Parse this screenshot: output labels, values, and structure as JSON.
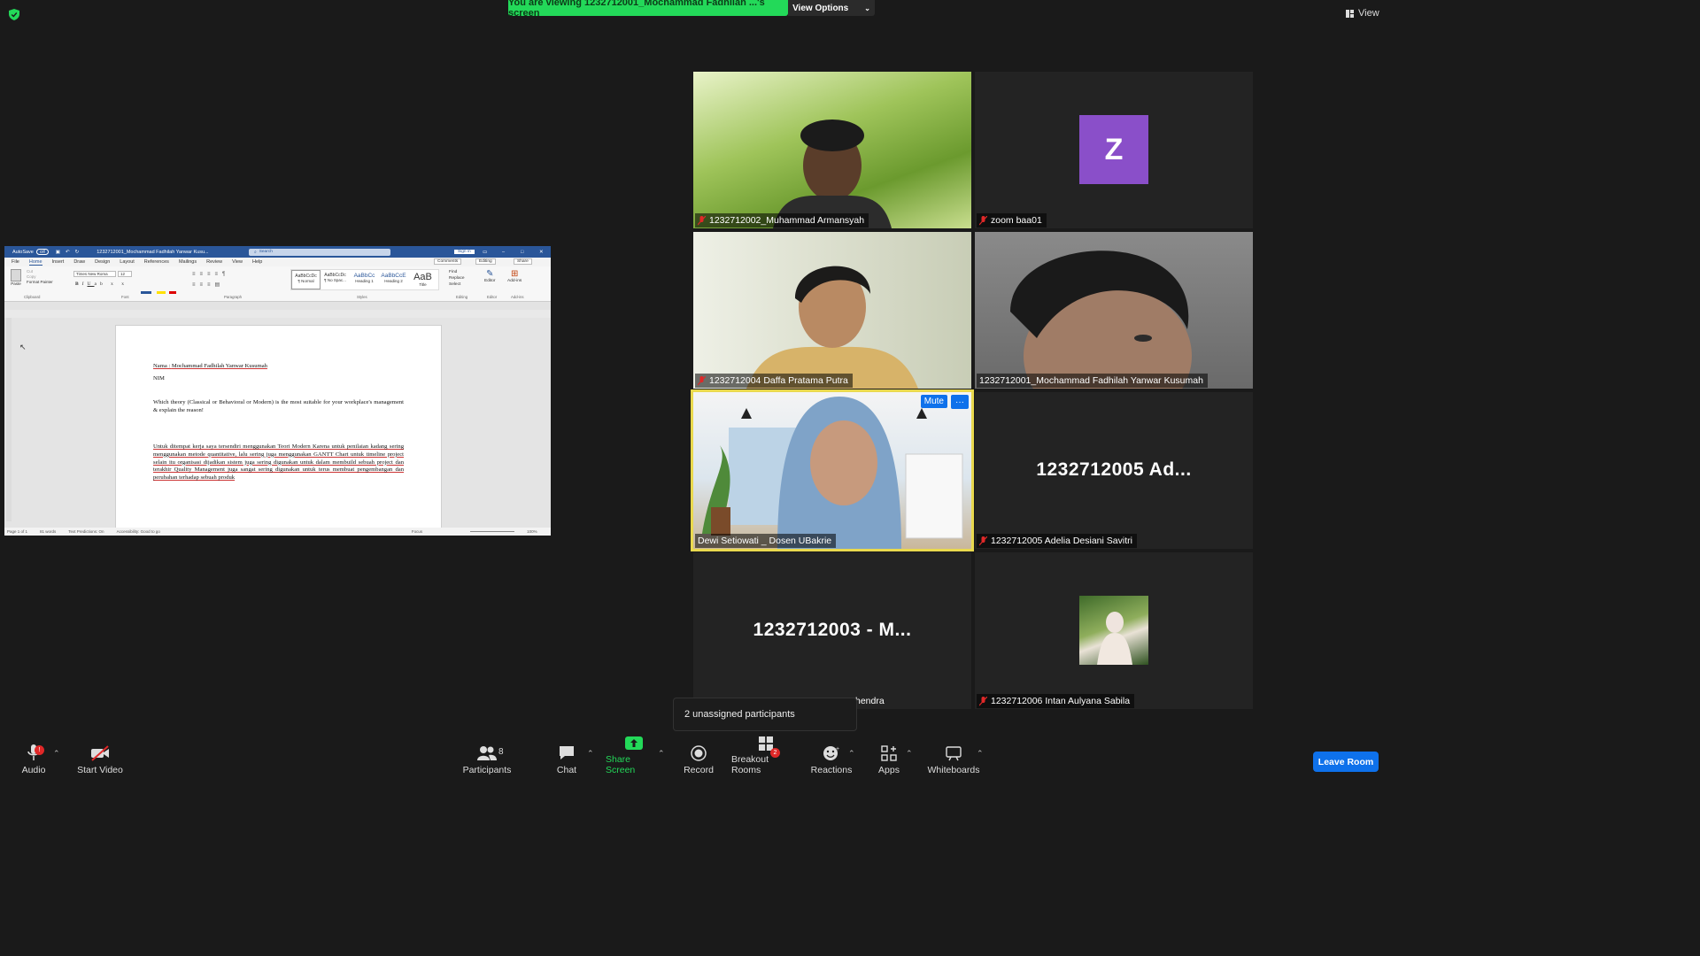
{
  "banner": {
    "viewing_text": "You are viewing 1232712001_Mochammad Fadhilah ...'s screen",
    "view_options": "View Options"
  },
  "top_right": {
    "view_label": "View"
  },
  "tiles": [
    {
      "name": "1232712002_Muhammad Armansyah",
      "muted": true
    },
    {
      "name": "zoom baa01",
      "muted": true,
      "avatar_letter": "Z"
    },
    {
      "name": "1232712004 Daffa Pratama Putra",
      "muted": true
    },
    {
      "name": "1232712001_Mochammad Fadhilah Yanwar Kusumah",
      "muted": false
    },
    {
      "name": "Dewi Setiowati _ Dosen UBakrie",
      "muted": false,
      "mute_button": "Mute",
      "more_button": "···"
    },
    {
      "name": "1232712005 Adelia Desiani Savitri",
      "muted": true,
      "big_label": "1232712005  Ad..."
    },
    {
      "name": "hendra",
      "muted": false,
      "big_label": "1232712003  -  M..."
    },
    {
      "name": "1232712006 Intan Aulyana Sabila",
      "muted": true
    }
  ],
  "doc": {
    "autosave": "AutoSave",
    "toggle": "Off",
    "file_title": "1232712001_Mochammad Fadhilah Yanwar Kusu...",
    "search": "Search",
    "signin": "Sign in",
    "menu": [
      "File",
      "Home",
      "Insert",
      "Draw",
      "Design",
      "Layout",
      "References",
      "Mailings",
      "Review",
      "View",
      "Help"
    ],
    "comments": "Comments",
    "editing": "Editing",
    "share": "Share",
    "clipboard": {
      "paste": "Paste",
      "cut": "Cut",
      "copy": "Copy",
      "format_painter": "Format Painter",
      "group": "Clipboard"
    },
    "font": {
      "name": "Times New Roma",
      "size": "12",
      "group": "Font"
    },
    "paragraph_group": "Paragraph",
    "styles": [
      {
        "preview": "AaBbCcDc",
        "label": "¶ Normal"
      },
      {
        "preview": "AaBbCcDc",
        "label": "¶ No Spac..."
      },
      {
        "preview": "AaBbCc",
        "label": "Heading 1"
      },
      {
        "preview": "AaBbCcE",
        "label": "Heading 2"
      },
      {
        "preview": "AaB",
        "label": "Title"
      }
    ],
    "styles_group": "Styles",
    "editing_group": {
      "find": "Find",
      "replace": "Replace",
      "select": "Select",
      "group": "Editing"
    },
    "editor": {
      "label": "Editor",
      "group": "Editor"
    },
    "addins": {
      "label": "Add-ins",
      "group": "Add-ins"
    },
    "page": {
      "line1_prefix": "Nama : ",
      "line1_name": "Mochammad Fadhilah Yanwar Kusumah",
      "line2": "NIM",
      "question": "Which theory (Classical or Behavioral or Modern) is the most suitable for your workplace's management & explain the reason!",
      "answer": "Untuk ditempat kerja saya tersendiri menggunakan Teori Modern Karena untuk penilaian kadang sering menggunakan metode quantitative, lalu sering juga menggunakan GANTT Chart untuk timeline project selain itu organisasi dijadikan sistem juga sering digunakan untuk dalam membuild sebuah project dan terakhir Quality Management juga sangat sering digunakan untuk terus membuat pengembangan dan perubahan terhadap sebuah produk"
    },
    "status": {
      "page": "Page 1 of 1",
      "words": "81 words",
      "predictions": "Text Predictions: On",
      "accessibility": "Accessibility: Good to go",
      "focus": "Focus",
      "zoom": "100%"
    }
  },
  "tooltip": "2 unassigned participants",
  "toolbar": {
    "audio": "Audio",
    "audio_badge": "!",
    "start_video": "Start Video",
    "participants": "Participants",
    "participants_count": "8",
    "chat": "Chat",
    "share_screen": "Share Screen",
    "record": "Record",
    "breakout_rooms": "Breakout Rooms",
    "breakout_badge": "2",
    "reactions": "Reactions",
    "apps": "Apps",
    "whiteboards": "Whiteboards",
    "leave": "Leave Room"
  },
  "colors": {
    "share_green": "#23d959",
    "speaker_border": "#e9d94e",
    "leave_blue": "#0e71eb",
    "avatar_purple": "#8a4fc9",
    "badge_red": "#e02828"
  }
}
